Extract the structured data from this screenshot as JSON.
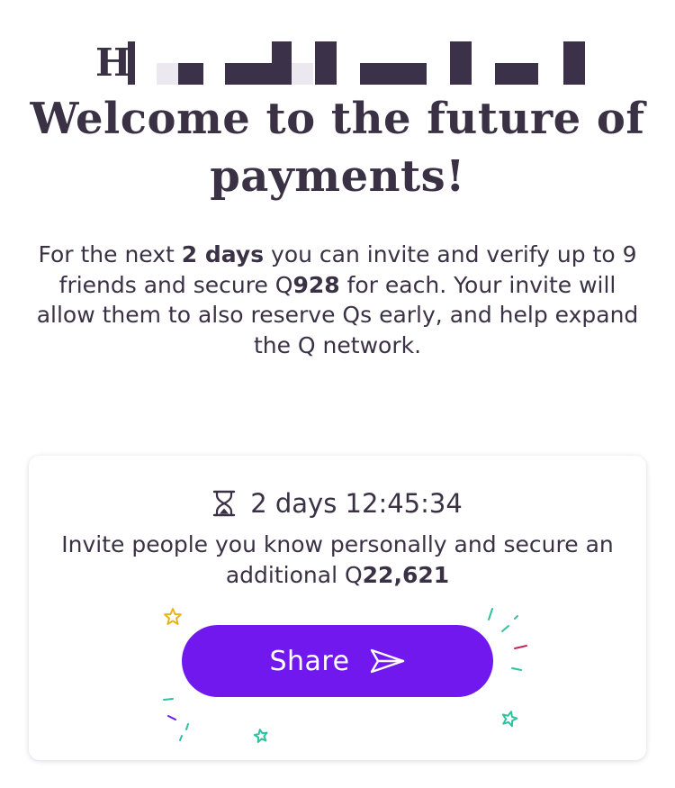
{
  "greeting": {
    "visible_initial": "H"
  },
  "headline": "Welcome to the future of payments!",
  "intro": {
    "part1": "For the next ",
    "days_bold": "2 days",
    "part2": " you can invite and verify up to 9 friends and secure Q",
    "amount_bold": "928",
    "part3": " for each. Your invite will allow them to also reserve Qs early, and help expand the Q network."
  },
  "card": {
    "timer_icon": "hourglass-icon",
    "countdown": "2 days 12:45:34",
    "text_part1": "Invite people you know personally and secure an additional Q",
    "bonus_bold": "22,621",
    "share_label": "Share",
    "share_icon": "send-icon"
  },
  "colors": {
    "text": "#3a3145",
    "accent": "#7018ee",
    "card_bg": "#ffffff",
    "confetti_yellow": "#e8b321",
    "confetti_teal": "#2fc2a0",
    "confetti_red": "#c9245a",
    "confetti_purple": "#7018ee"
  }
}
